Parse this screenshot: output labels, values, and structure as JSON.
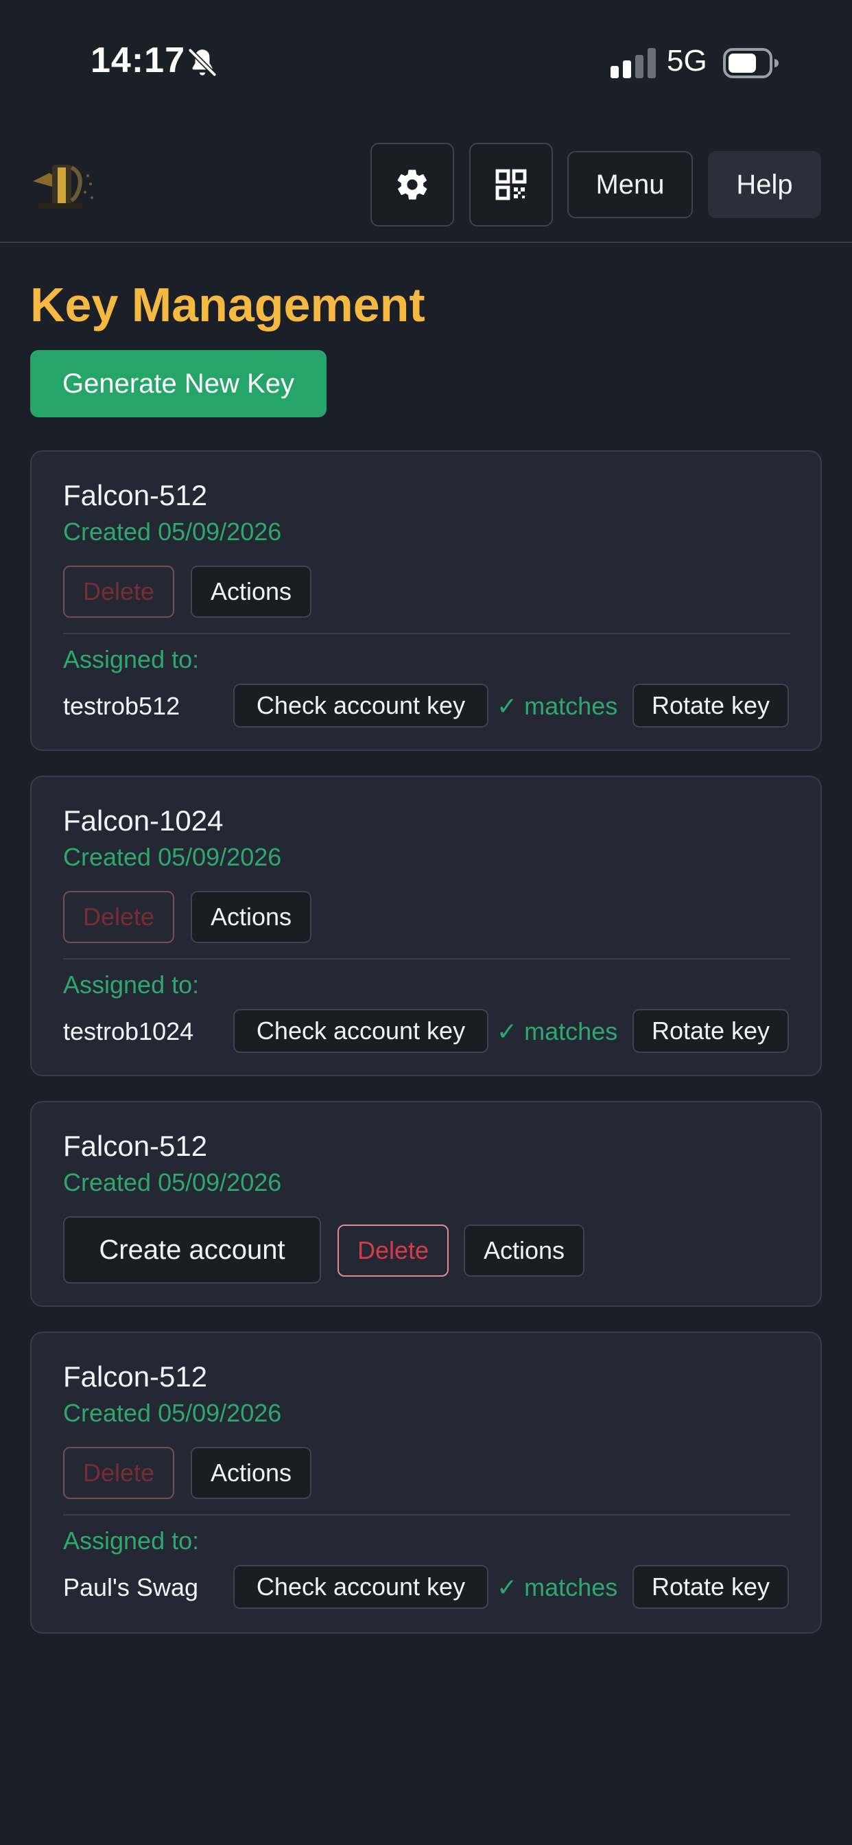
{
  "status_bar": {
    "time": "14:17",
    "network": "5G",
    "icons": [
      "bell-slash-icon",
      "signal-icon",
      "battery-icon"
    ]
  },
  "header": {
    "logo_icon": "app-logo",
    "settings_icon": "gear-icon",
    "qr_icon": "qr-code-icon",
    "menu_label": "Menu",
    "help_label": "Help"
  },
  "page": {
    "title": "Key Management",
    "generate_label": "Generate New Key"
  },
  "colors": {
    "background": "#1b1f27",
    "title": "#f5b942",
    "accent_green": "#26a56a",
    "danger": "#d73a48"
  },
  "keys": [
    {
      "name": "Falcon-512",
      "created": "Created 05/09/2026",
      "delete_label": "Delete",
      "actions_label": "Actions",
      "assigned_label": "Assigned to:",
      "account": "testrob512",
      "check_label": "Check account key",
      "match_status": "✓ matches",
      "rotate_label": "Rotate key"
    },
    {
      "name": "Falcon-1024",
      "created": "Created 05/09/2026",
      "delete_label": "Delete",
      "actions_label": "Actions",
      "assigned_label": "Assigned to:",
      "account": "testrob1024",
      "check_label": "Check account key",
      "match_status": "✓ matches",
      "rotate_label": "Rotate key"
    },
    {
      "name": "Falcon-512",
      "created": "Created 05/09/2026",
      "create_account_label": "Create account",
      "delete_label": "Delete",
      "actions_label": "Actions"
    },
    {
      "name": "Falcon-512",
      "created": "Created 05/09/2026",
      "delete_label": "Delete",
      "actions_label": "Actions",
      "assigned_label": "Assigned to:",
      "account": "Paul's Swag",
      "check_label": "Check account key",
      "match_status": "✓ matches",
      "rotate_label": "Rotate key"
    }
  ]
}
